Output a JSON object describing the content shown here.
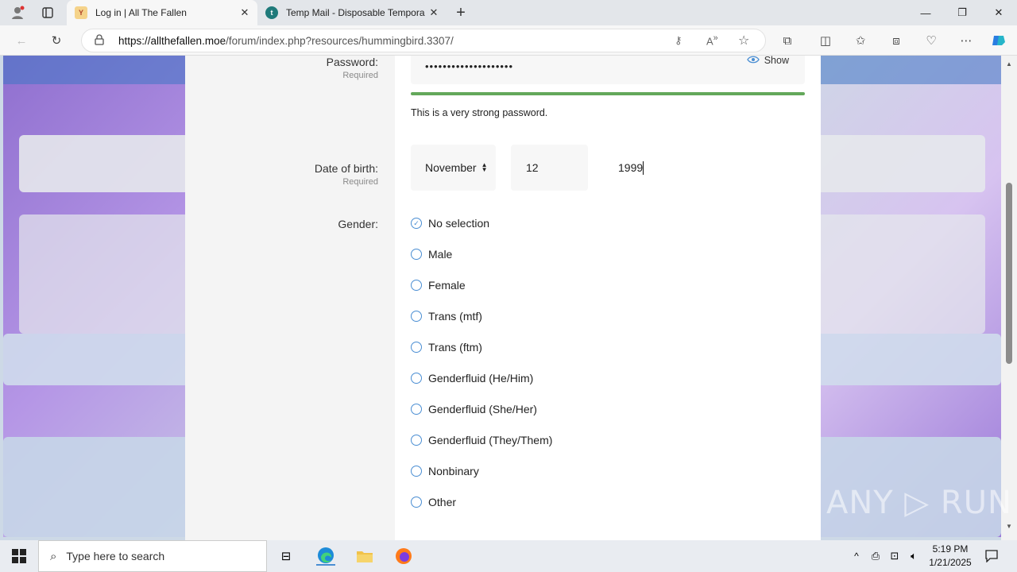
{
  "browser": {
    "tabs": [
      {
        "title": "Log in | All The Fallen",
        "active": true
      },
      {
        "title": "Temp Mail - Disposable Tempora",
        "active": false
      }
    ],
    "url_host": "https://allthefallen.moe",
    "url_path": "/forum/index.php?resources/hummingbird.3307/"
  },
  "form": {
    "password": {
      "label": "Password:",
      "required": "Required",
      "value": "••••••••••••••••••••",
      "show_label": "Show",
      "strength_text": "This is a very strong password.",
      "strength_level": 1.0
    },
    "dob": {
      "label": "Date of birth:",
      "required": "Required",
      "month": "November",
      "day": "12",
      "year": "1999"
    },
    "gender": {
      "label": "Gender:",
      "options": [
        {
          "label": "No selection",
          "selected": true
        },
        {
          "label": "Male",
          "selected": false
        },
        {
          "label": "Female",
          "selected": false
        },
        {
          "label": "Trans (mtf)",
          "selected": false
        },
        {
          "label": "Trans (ftm)",
          "selected": false
        },
        {
          "label": "Genderfluid (He/Him)",
          "selected": false
        },
        {
          "label": "Genderfluid (She/Her)",
          "selected": false
        },
        {
          "label": "Genderfluid (They/Them)",
          "selected": false
        },
        {
          "label": "Nonbinary",
          "selected": false
        },
        {
          "label": "Other",
          "selected": false
        }
      ]
    }
  },
  "watermark": "ANY ▷ RUN",
  "taskbar": {
    "search_placeholder": "Type here to search",
    "time": "5:19 PM",
    "date": "1/21/2025"
  },
  "colors": {
    "accent": "#4a8ed3",
    "strength": "#63a85a"
  }
}
